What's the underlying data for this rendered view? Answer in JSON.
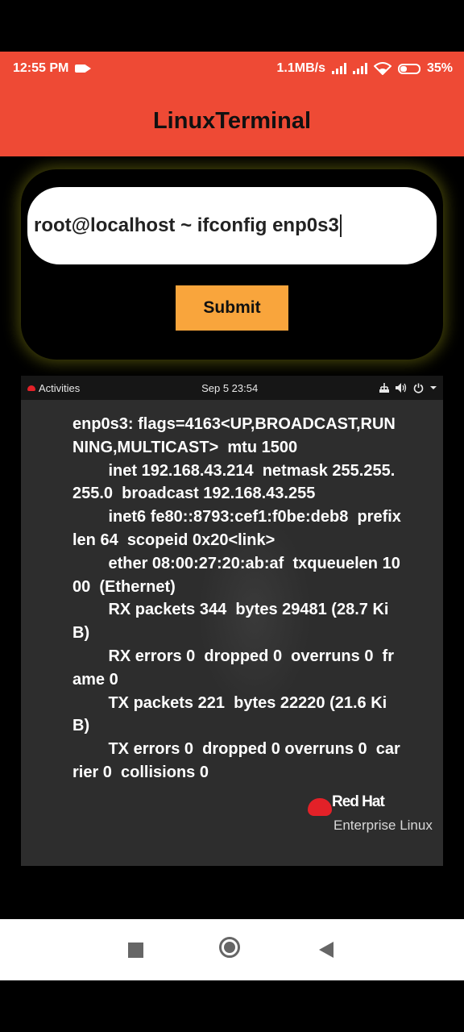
{
  "status_bar": {
    "time": "12:55 PM",
    "speed": "1.1MB/s",
    "battery": "35%"
  },
  "app": {
    "title": "LinuxTerminal"
  },
  "command_input": {
    "value": "root@localhost ~ ifconfig enp0s3"
  },
  "submit": {
    "label": "Submit"
  },
  "desktop": {
    "activities_label": "Activities",
    "clock": "Sep 5  23:54",
    "output": "enp0s3: flags=4163<UP,BROADCAST,RUNNING,MULTICAST>  mtu 1500\n        inet 192.168.43.214  netmask 255.255.255.0  broadcast 192.168.43.255\n        inet6 fe80::8793:cef1:f0be:deb8  prefixlen 64  scopeid 0x20<link>\n        ether 08:00:27:20:ab:af  txqueuelen 1000  (Ethernet)\n        RX packets 344  bytes 29481 (28.7 KiB)\n        RX errors 0  dropped 0  overruns 0  frame 0\n        TX packets 221  bytes 22220 (21.6 KiB)\n        TX errors 0  dropped 0 overruns 0  carrier 0  collisions 0",
    "brand": "Red Hat",
    "brand_sub": "Enterprise Linux"
  },
  "icons": {
    "status": [
      "video-camera-icon",
      "signal-icon",
      "wifi-icon",
      "battery-icon"
    ],
    "desktop_tray": [
      "network-icon",
      "volume-icon",
      "power-icon",
      "dropdown-icon"
    ],
    "nav": [
      "recents-icon",
      "home-icon",
      "back-icon"
    ]
  },
  "colors": {
    "accent": "#ee4a35",
    "button": "#f9a53c",
    "redhat": "#e32128"
  }
}
